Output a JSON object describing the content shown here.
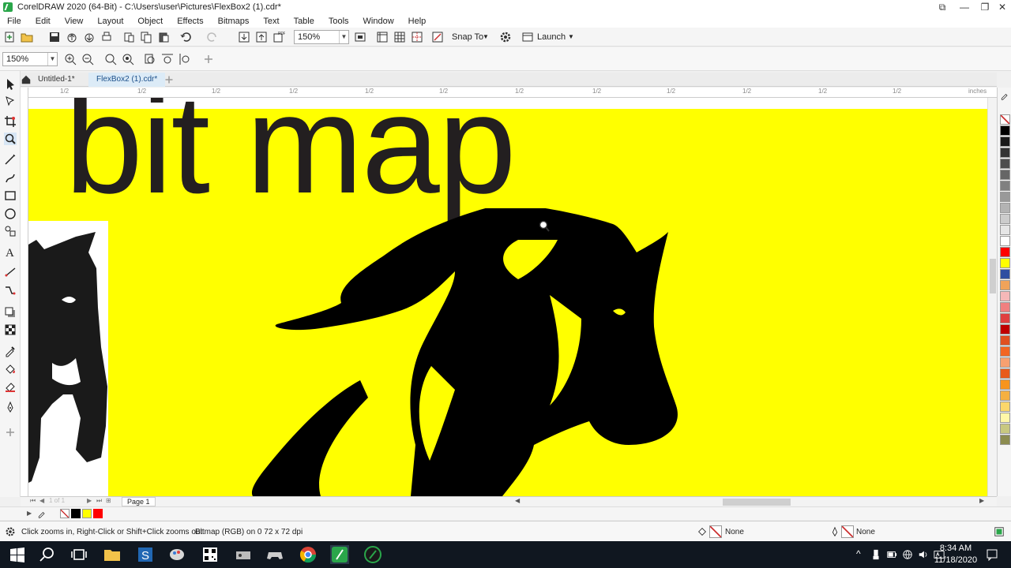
{
  "window": {
    "title": "CorelDRAW 2020 (64-Bit) - C:\\Users\\user\\Pictures\\FlexBox2 (1).cdr*"
  },
  "menu": [
    "File",
    "Edit",
    "View",
    "Layout",
    "Object",
    "Effects",
    "Bitmaps",
    "Text",
    "Table",
    "Tools",
    "Window",
    "Help"
  ],
  "toolbar": {
    "zoom": "150%",
    "snap_to": "Snap To",
    "launch": "Launch"
  },
  "propbar": {
    "zoom": "150%"
  },
  "tabs": [
    {
      "label": "Untitled-1*"
    },
    {
      "label": "FlexBox2 (1).cdr*"
    }
  ],
  "ruler": {
    "units": "inches",
    "labels": [
      "1/2",
      "1/2",
      "1/2",
      "1/2",
      "1/2",
      "1/2",
      "1/2",
      "1/2",
      "1/2",
      "1/2",
      "1/2",
      "1/2",
      "1/2"
    ]
  },
  "canvas": {
    "text": "bit map"
  },
  "docnav": {
    "page_of": "1 of 1",
    "page_tab": "Page 1"
  },
  "status": {
    "hint": "Click zooms in, Right-Click or Shift+Click zooms out",
    "selection": "Bitmap (RGB) on 0 72 x 72 dpi",
    "fill": "None",
    "outline": "None"
  },
  "taskbar": {
    "time": "8:34 AM",
    "date": "11/18/2020"
  },
  "colors": {
    "page_fill": "#ffff00",
    "ink": "#231f20",
    "accent": "#2aa64a"
  }
}
